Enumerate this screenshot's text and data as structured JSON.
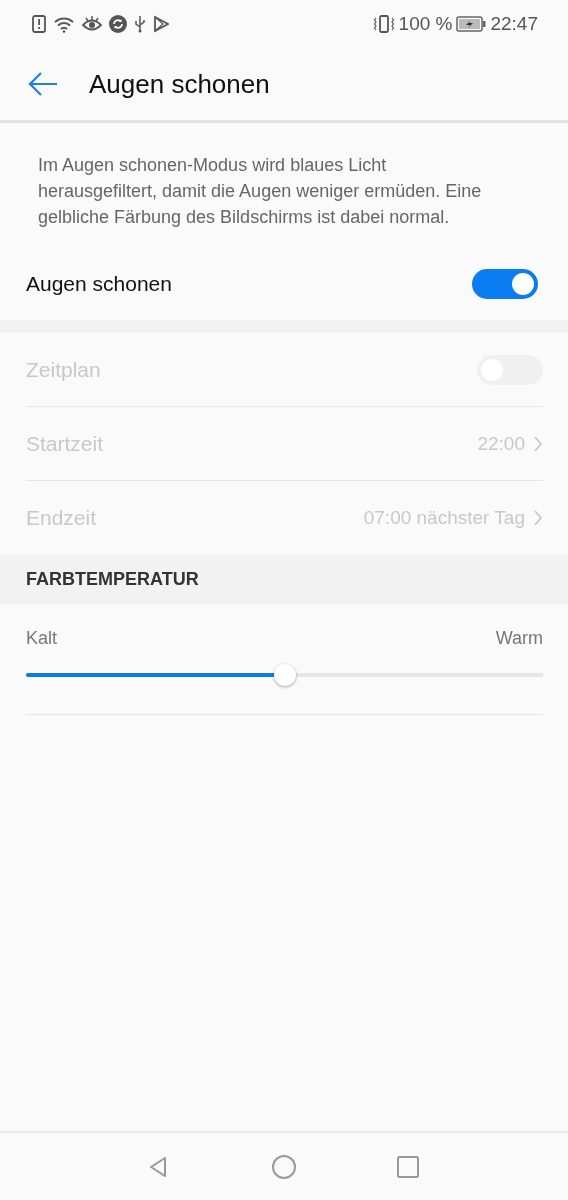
{
  "status_bar": {
    "battery_percent": "100 %",
    "time": "22:47"
  },
  "header": {
    "title": "Augen schonen"
  },
  "description": "Im Augen schonen-Modus wird blaues Licht herausgefiltert, damit die Augen weniger ermüden. Eine gelbliche Färbung des Bildschirms ist dabei normal.",
  "main_toggle": {
    "label": "Augen schonen",
    "on": true
  },
  "schedule": [
    {
      "kind": "toggle",
      "label": "Zeitplan",
      "on": false,
      "disabled": true
    },
    {
      "kind": "link",
      "label": "Startzeit",
      "value": "22:00",
      "disabled": true
    },
    {
      "kind": "link",
      "label": "Endzeit",
      "value": "07:00 nächster Tag",
      "disabled": true
    }
  ],
  "color_temperature": {
    "heading": "FARBTEMPERATUR",
    "left_label": "Kalt",
    "right_label": "Warm",
    "level": 0.5
  }
}
